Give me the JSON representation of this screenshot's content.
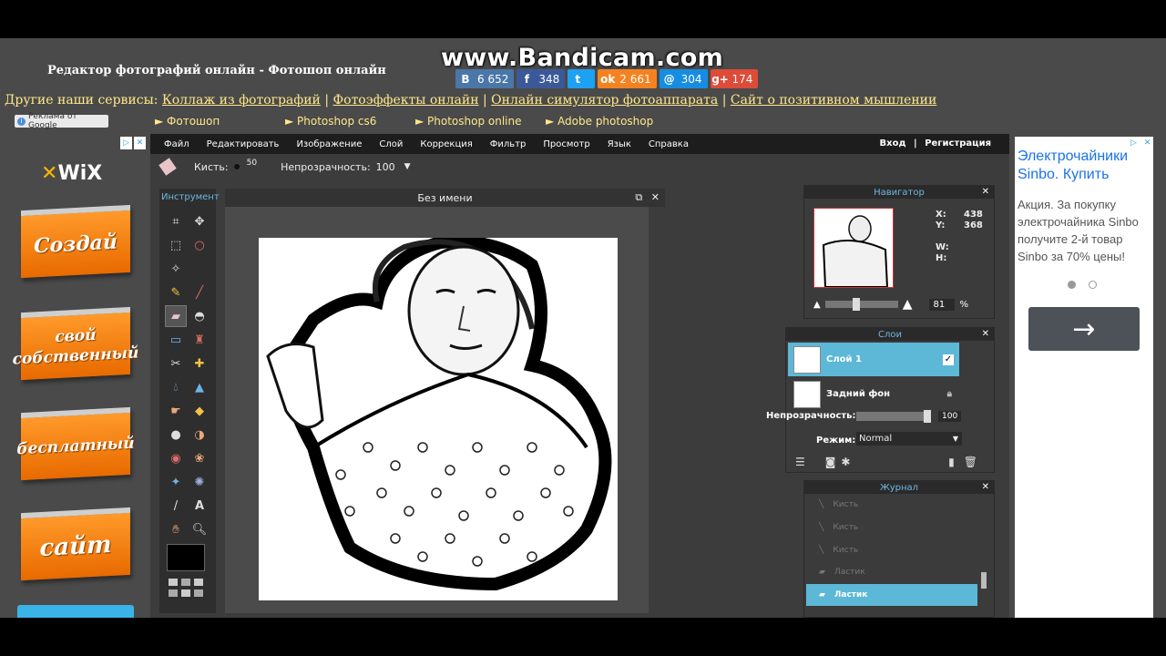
{
  "site": {
    "title": "Редактор фотографий онлайн - Фотошоп онлайн",
    "watermark": "www.Bandicam.com",
    "services_label": "Другие наши сервисы:",
    "services": [
      "Коллаж из фотографий",
      "Фотоэффекты онлайн",
      "Онлайн симулятор фотоаппарата",
      "Сайт о позитивном мышлении"
    ],
    "ads_by": "Реклама от Google",
    "top_links": [
      "► Фотошоп",
      "► Photoshop cs6",
      "► Photoshop online",
      "► Adobe photoshop"
    ]
  },
  "shares": [
    {
      "icon": "vk-icon",
      "glyph": "В",
      "count": "6 652",
      "color": "#4a76a8"
    },
    {
      "icon": "facebook-icon",
      "glyph": "f",
      "count": "348",
      "color": "#3b5998"
    },
    {
      "icon": "twitter-icon",
      "glyph": "t",
      "count": "",
      "color": "#1da1f2"
    },
    {
      "icon": "odnoklassniki-icon",
      "glyph": "ok",
      "count": "2 661",
      "color": "#f58220"
    },
    {
      "icon": "mail-icon",
      "glyph": "@",
      "count": "304",
      "color": "#168de2"
    },
    {
      "icon": "googleplus-icon",
      "glyph": "g+",
      "count": "174",
      "color": "#dd4b39"
    }
  ],
  "left_ad": {
    "brand": "WiX",
    "buttons": [
      "Создай",
      "свой собственный",
      "бесплатный",
      "сайт"
    ]
  },
  "editor": {
    "menu": [
      "Файл",
      "Редактировать",
      "Изображение",
      "Слой",
      "Коррекция",
      "Фильтр",
      "Просмотр",
      "Язык",
      "Справка"
    ],
    "login": "Вход",
    "separator": "|",
    "register": "Регистрация",
    "brush_label": "Кисть:",
    "brush_size": "50",
    "opacity_label": "Непрозрачность:",
    "opacity_value": "100",
    "tools_title": "Инструмент",
    "doc_title": "Без имени"
  },
  "navigator": {
    "title": "Навигатор",
    "x_label": "X:",
    "x_value": "438",
    "y_label": "Y:",
    "y_value": "368",
    "w_label": "W:",
    "h_label": "H:",
    "zoom": "81",
    "zoom_unit": "%"
  },
  "layers": {
    "title": "Слои",
    "items": [
      "Слой 1",
      "Задний фон"
    ],
    "opacity_label": "Непрозрачность:",
    "opacity_value": "100",
    "mode_label": "Режим:",
    "mode_value": "Normal"
  },
  "history": {
    "title": "Журнал",
    "items": [
      "Кисть",
      "Кисть",
      "Кисть",
      "Ластик",
      "Ластик"
    ]
  },
  "right_ad": {
    "title": "Электрочайники Sinbo. Купить",
    "body": "Акция. За покупку электрочайника Sinbo получите 2-й товар Sinbo за 70% цены!",
    "arrow": "→"
  },
  "colors": {
    "accent": "#5cb8d6",
    "link": "#ffe88a",
    "panel_title": "#6db8e0"
  }
}
